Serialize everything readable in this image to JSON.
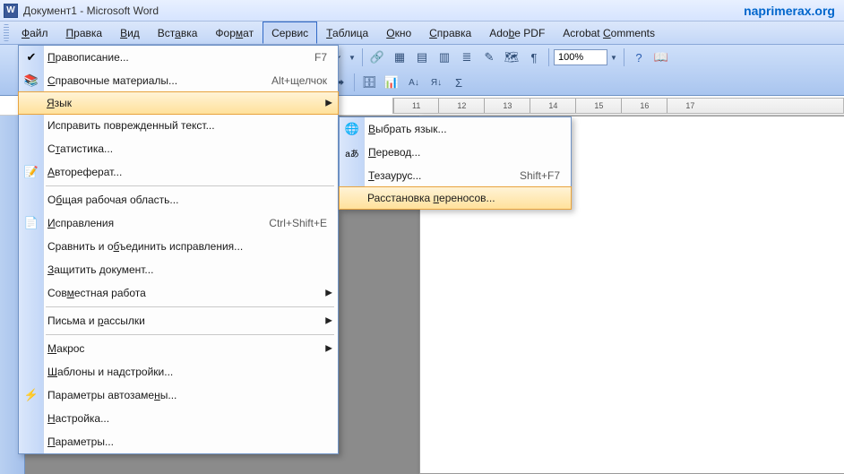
{
  "title": "Документ1 - Microsoft Word",
  "watermark": "naprimerax.org",
  "menubar": {
    "file": "Файл",
    "edit": "Правка",
    "view": "Вид",
    "insert": "Вставка",
    "format": "Формат",
    "tools": "Сервис",
    "table": "Таблица",
    "window": "Окно",
    "help": "Справка",
    "adobe": "Adobe PDF",
    "acrobat": "Acrobat Comments"
  },
  "toolbar": {
    "zoom": "100%"
  },
  "ruler": {
    "marks": [
      "11",
      "12",
      "13",
      "14",
      "15",
      "16",
      "17"
    ]
  },
  "tools_menu": {
    "spelling": {
      "label": "Правописание...",
      "shortcut": "F7"
    },
    "research": {
      "label": "Справочные материалы...",
      "shortcut": "Alt+щелчок"
    },
    "language": {
      "label": "Язык"
    },
    "fix_broken": {
      "label": "Исправить поврежденный текст..."
    },
    "statistics": {
      "label": "Статистика..."
    },
    "autosummary": {
      "label": "Автореферат..."
    },
    "shared_workspace": {
      "label": "Общая рабочая область..."
    },
    "track_changes": {
      "label": "Исправления",
      "shortcut": "Ctrl+Shift+E"
    },
    "compare_merge": {
      "label": "Сравнить и объединить исправления..."
    },
    "protect": {
      "label": "Защитить документ..."
    },
    "collab": {
      "label": "Совместная работа"
    },
    "mail": {
      "label": "Письма и рассылки"
    },
    "macro": {
      "label": "Макрос"
    },
    "templates": {
      "label": "Шаблоны и надстройки..."
    },
    "autocorrect": {
      "label": "Параметры автозамены..."
    },
    "customize": {
      "label": "Настройка..."
    },
    "options": {
      "label": "Параметры..."
    }
  },
  "language_submenu": {
    "choose": {
      "label": "Выбрать язык..."
    },
    "translate": {
      "label": "Перевод..."
    },
    "thesaurus": {
      "label": "Тезаурус...",
      "shortcut": "Shift+F7"
    },
    "hyphenation": {
      "label": "Расстановка переносов..."
    }
  }
}
